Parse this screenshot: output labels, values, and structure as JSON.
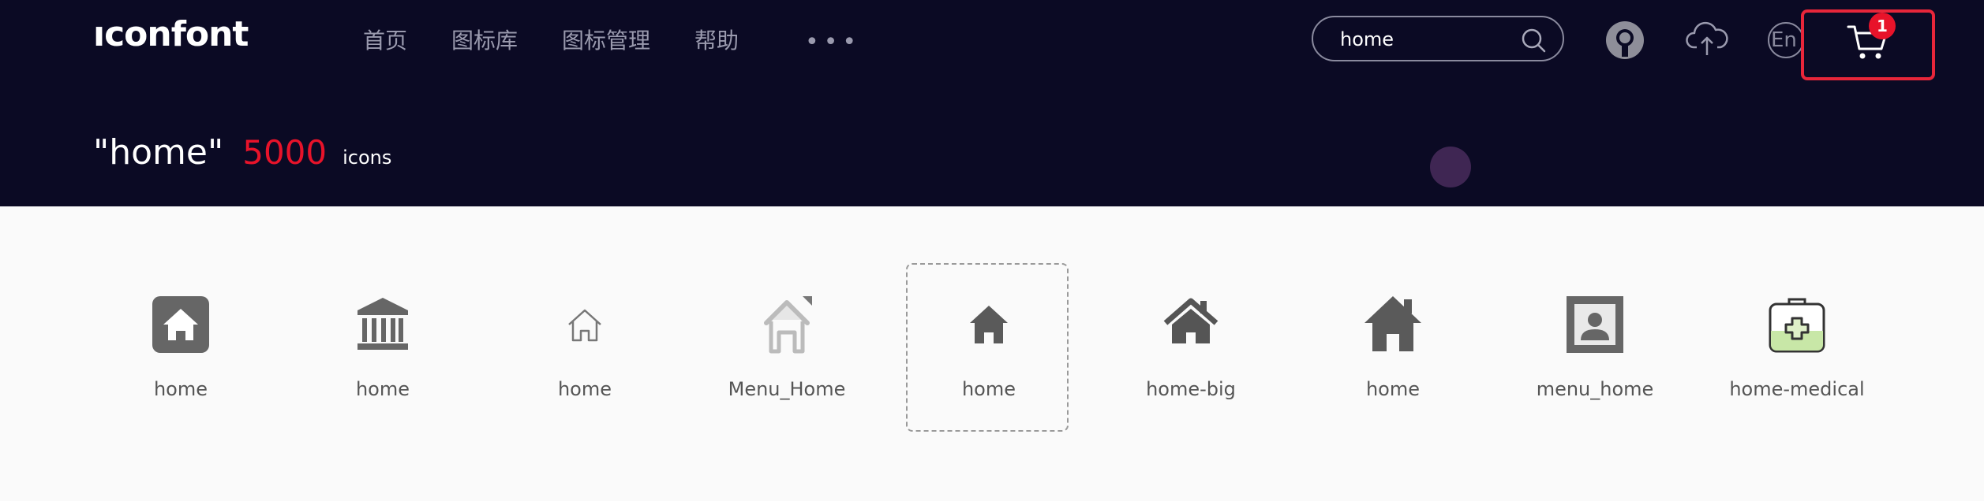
{
  "header": {
    "logo": "ıconfont",
    "nav": [
      "首页",
      "图标库",
      "图标管理",
      "帮助"
    ],
    "more": "•••",
    "search": {
      "value": "home",
      "icon": "search-icon"
    },
    "lang": "En",
    "cart_count": "1",
    "colors": {
      "background": "#0b0a24",
      "accent": "#e8132a"
    }
  },
  "result": {
    "query": "\"home\"",
    "count": "5000",
    "unit": "icons"
  },
  "icons": [
    {
      "name": "home",
      "icon": "home-rounded-square-icon"
    },
    {
      "name": "home",
      "icon": "bank-building-icon"
    },
    {
      "name": "home",
      "icon": "home-outline-icon"
    },
    {
      "name": "Menu_Home",
      "icon": "home-flag-icon"
    },
    {
      "name": "home",
      "icon": "home-solid-small-icon",
      "selected": true
    },
    {
      "name": "home-big",
      "icon": "home-chimney-icon"
    },
    {
      "name": "home",
      "icon": "home-solid-large-icon"
    },
    {
      "name": "menu_home",
      "icon": "profile-frame-icon"
    },
    {
      "name": "home-medical",
      "icon": "medical-kit-icon"
    }
  ]
}
